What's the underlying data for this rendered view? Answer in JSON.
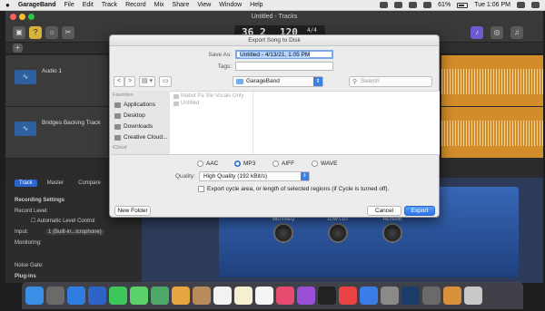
{
  "menubar": {
    "apple": "",
    "app": "GarageBand",
    "items": [
      "File",
      "Edit",
      "Track",
      "Record",
      "Mix",
      "Share",
      "View",
      "Window",
      "Help"
    ],
    "battery": "61%",
    "clock": "Tue 1:06 PM"
  },
  "window": {
    "title": "Untitled - Tracks"
  },
  "lcd": {
    "bar": "36",
    "beat": "2",
    "tempo": "120",
    "signature": "4/4"
  },
  "tracks": [
    {
      "name": "Audio 1"
    },
    {
      "name": "Bridges Backing Track"
    }
  ],
  "lower_panel": {
    "tabs": [
      "Track",
      "Master",
      "Compare"
    ],
    "section": "Recording Settings",
    "record_level": "Record Level:",
    "auto_level": "Automatic Level Control",
    "input_label": "Input:",
    "input_value": "1 (Built-in...icrophone)",
    "monitoring": "Monitoring:",
    "noise_gate": "Noise Gate:",
    "plugins": "Plug-ins"
  },
  "plugin": {
    "labels": [
      "MID FREQ",
      "LOW CUT",
      "REVERB"
    ]
  },
  "dialog": {
    "title": "Export Song to Disk",
    "save_as_label": "Save As:",
    "save_as_value": "Untitled - 4/13/21, 1.05 PM",
    "tags_label": "Tags:",
    "tags_value": "",
    "nav_back": "<",
    "nav_fwd": ">",
    "view_mode": "▤ ▾",
    "location": "GarageBand",
    "search_placeholder": "Search",
    "sidebar": {
      "favorites_header": "Favorites",
      "favorites": [
        "Applications",
        "Desktop",
        "Downloads",
        "Creative Cloud..."
      ],
      "icloud_header": "iCloud"
    },
    "files": [
      "Mabut Pa Sle Vocals Only",
      "Untitled"
    ],
    "formats": [
      "AAC",
      "MP3",
      "AIFF",
      "WAVE"
    ],
    "selected_format": "MP3",
    "quality_label": "Quality:",
    "quality_value": "High Quality (192 kBit/s)",
    "cycle_label": "Export cycle area, or length of selected regions (if Cycle is turned off).",
    "new_folder": "New Folder",
    "cancel": "Cancel",
    "export": "Export"
  },
  "colors": {
    "accent": "#2d74e6",
    "region": "#d28c2a",
    "plugin_blue": "#3867b7"
  }
}
